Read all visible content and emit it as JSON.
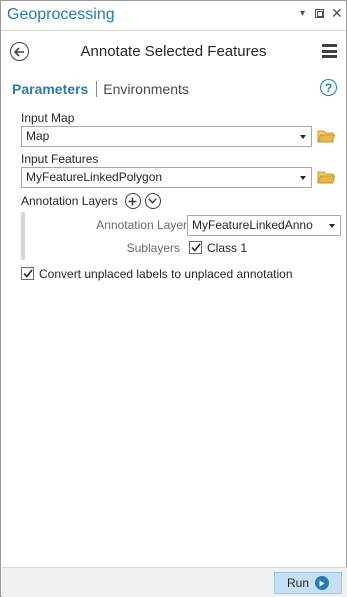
{
  "window": {
    "title": "Geoprocessing",
    "controls": [
      "pin",
      "restore",
      "close"
    ]
  },
  "header": {
    "tool_title": "Annotate Selected Features",
    "back_icon": "back-arrow-circle-icon",
    "menu_icon": "hamburger-menu-icon"
  },
  "tabs": {
    "active": "Parameters",
    "inactive": "Environments",
    "help": "?"
  },
  "params": {
    "input_map": {
      "label": "Input Map",
      "value": "Map"
    },
    "input_features": {
      "label": "Input Features",
      "value": "MyFeatureLinkedPolygon"
    },
    "annotation_layers": {
      "label": "Annotation Layers",
      "layer_label": "Annotation Layer",
      "layer_value": "MyFeatureLinkedAnno",
      "sublayers_label": "Sublayers",
      "sublayer_item": "Class 1",
      "sublayer_checked": true
    },
    "convert_unplaced": {
      "label": "Convert unplaced labels to unplaced annotation",
      "checked": true
    }
  },
  "footer": {
    "run_label": "Run"
  },
  "colors": {
    "accent": "#2a7ab5",
    "run_bg": "#c5dff3",
    "folder": "#e8b84a"
  }
}
